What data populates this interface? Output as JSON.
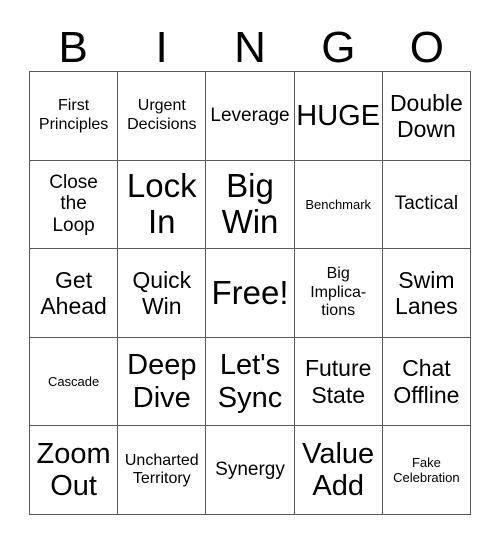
{
  "card": {
    "title": "BINGO",
    "header_letters": [
      "B",
      "I",
      "N",
      "G",
      "O"
    ],
    "columns": 5,
    "rows": 5,
    "border_color": "#5a5a5a",
    "text_color": "#000000",
    "background_color": "#ffffff",
    "cells": [
      {
        "text": "First\nPrinciples",
        "size": "s",
        "free": false
      },
      {
        "text": "Urgent\nDecisions",
        "size": "s",
        "free": false
      },
      {
        "text": "Leverage",
        "size": "m",
        "free": false
      },
      {
        "text": "HUGE",
        "size": "xl",
        "free": false
      },
      {
        "text": "Double\nDown",
        "size": "l",
        "free": false
      },
      {
        "text": "Close\nthe\nLoop",
        "size": "m",
        "free": false
      },
      {
        "text": "Lock\nIn",
        "size": "xxl",
        "free": false
      },
      {
        "text": "Big\nWin",
        "size": "xxl",
        "free": false
      },
      {
        "text": "Benchmark",
        "size": "xs",
        "free": false
      },
      {
        "text": "Tactical",
        "size": "m",
        "free": false
      },
      {
        "text": "Get\nAhead",
        "size": "l",
        "free": false
      },
      {
        "text": "Quick\nWin",
        "size": "l",
        "free": false
      },
      {
        "text": "Free!",
        "size": "xxl",
        "free": true
      },
      {
        "text": "Big\nImplica-\ntions",
        "size": "s",
        "free": false
      },
      {
        "text": "Swim\nLanes",
        "size": "l",
        "free": false
      },
      {
        "text": "Cascade",
        "size": "xs",
        "free": false
      },
      {
        "text": "Deep\nDive",
        "size": "xl",
        "free": false
      },
      {
        "text": "Let's\nSync",
        "size": "xl",
        "free": false
      },
      {
        "text": "Future\nState",
        "size": "l",
        "free": false
      },
      {
        "text": "Chat\nOffline",
        "size": "l",
        "free": false
      },
      {
        "text": "Zoom\nOut",
        "size": "xl",
        "free": false
      },
      {
        "text": "Uncharted\nTerritory",
        "size": "s",
        "free": false
      },
      {
        "text": "Synergy",
        "size": "m",
        "free": false
      },
      {
        "text": "Value\nAdd",
        "size": "xl",
        "free": false
      },
      {
        "text": "Fake\nCelebration",
        "size": "xs",
        "free": false
      }
    ]
  }
}
